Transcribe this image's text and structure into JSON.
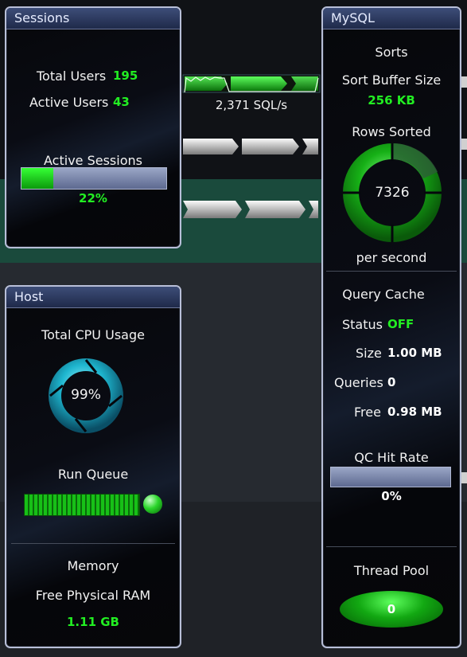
{
  "sessions": {
    "title": "Sessions",
    "total_users_label": "Total Users",
    "total_users_value": "195",
    "active_users_label": "Active Users",
    "active_users_value": "43",
    "active_sessions_label": "Active Sessions",
    "active_sessions_pct": "22%",
    "active_sessions_fraction": 0.22
  },
  "flow": {
    "sql_rate": "2,371 SQL/s"
  },
  "host": {
    "title": "Host",
    "cpu_label": "Total CPU Usage",
    "cpu_value": "99%",
    "run_queue_label": "Run Queue",
    "memory_label": "Memory",
    "free_ram_label": "Free Physical RAM",
    "free_ram_value": "1.11 GB"
  },
  "mysql": {
    "title": "MySQL",
    "sorts_label": "Sorts",
    "sort_buffer_label": "Sort Buffer Size",
    "sort_buffer_value": "256 KB",
    "rows_sorted_label": "Rows Sorted",
    "rows_sorted_value": "7326",
    "per_second_label": "per second",
    "query_cache_label": "Query Cache",
    "status_label": "Status",
    "status_value": "OFF",
    "size_label": "Size",
    "size_value": "1.00 MB",
    "queries_label": "Queries",
    "queries_value": "0",
    "free_label": "Free",
    "free_value": "0.98 MB",
    "qc_hit_rate_label": "QC Hit Rate",
    "qc_hit_rate_value": "0%",
    "qc_hit_rate_fraction": 0,
    "thread_pool_label": "Thread Pool",
    "thread_pool_value": "0"
  },
  "colors": {
    "accent_green": "#22ee22",
    "cpu_ring": "#1fb8d0",
    "panel_border": "#b8bfd8",
    "header_blue": "#2c3a62"
  }
}
